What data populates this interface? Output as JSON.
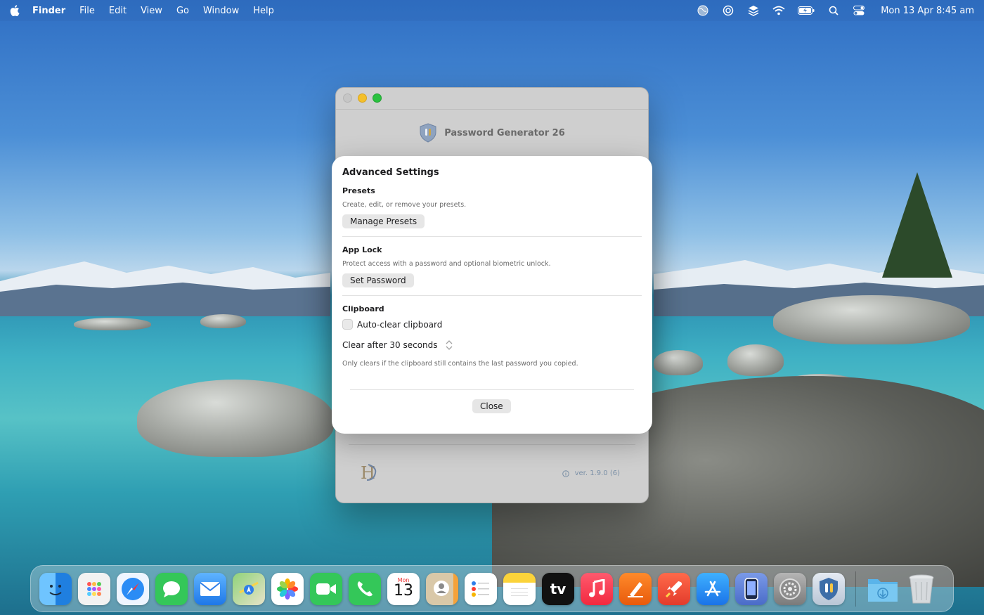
{
  "menubar": {
    "app_name": "Finder",
    "items": [
      "File",
      "Edit",
      "View",
      "Go",
      "Window",
      "Help"
    ],
    "clock": "Mon 13 Apr  8:45 am",
    "status_icons": [
      "globe-icon",
      "lifebuoy-icon",
      "layers-icon",
      "wifi-icon",
      "battery-charging-icon",
      "search-icon",
      "control-center-icon"
    ]
  },
  "window": {
    "title": "Password Generator 26",
    "version": "ver. 1.9.0 (6)",
    "logo_text": "H"
  },
  "sheet": {
    "title": "Advanced Settings",
    "presets": {
      "title": "Presets",
      "description": "Create, edit, or remove your presets.",
      "button": "Manage Presets"
    },
    "app_lock": {
      "title": "App Lock",
      "description": "Protect access with a password and optional biometric unlock.",
      "button": "Set Password"
    },
    "clipboard": {
      "title": "Clipboard",
      "checkbox_label": "Auto-clear clipboard",
      "checked": false,
      "stepper_label": "Clear after 30 seconds",
      "note": "Only clears if the clipboard still contains the last password you copied."
    },
    "close_button": "Close"
  },
  "dock": {
    "apps": [
      {
        "name": "finder-icon",
        "color": "#1f8ff0"
      },
      {
        "name": "launchpad-icon",
        "color": "#eeeeee"
      },
      {
        "name": "safari-icon",
        "color": "#e9f3ff"
      },
      {
        "name": "messages-icon",
        "color": "#34c759"
      },
      {
        "name": "mail-icon",
        "color": "#2f8df5"
      },
      {
        "name": "maps-icon",
        "color": "#5fc06a"
      },
      {
        "name": "photos-icon",
        "color": "#ffffff"
      },
      {
        "name": "facetime-icon",
        "color": "#34c759"
      },
      {
        "name": "phone-icon",
        "color": "#34c759"
      },
      {
        "name": "calendar-icon",
        "color": "#ffffff"
      },
      {
        "name": "contacts-icon",
        "color": "#c9b79a"
      },
      {
        "name": "reminders-icon",
        "color": "#ffffff"
      },
      {
        "name": "notes-icon",
        "color": "#fbe36b"
      },
      {
        "name": "apple-tv-icon",
        "color": "#111111"
      },
      {
        "name": "music-icon",
        "color": "#fa3a55"
      },
      {
        "name": "pages-icon",
        "color": "#f36b1f"
      },
      {
        "name": "rocket-icon",
        "color": "#ef4a3c"
      },
      {
        "name": "app-store-icon",
        "color": "#1e8df5"
      },
      {
        "name": "simulator-icon",
        "color": "#5a7bd6"
      },
      {
        "name": "system-settings-icon",
        "color": "#9a9a9a"
      },
      {
        "name": "password-generator-icon",
        "color": "#3d6ea8"
      }
    ],
    "calendar": {
      "month": "Mon",
      "day": "13"
    },
    "appletv_label": "tv",
    "trailing": [
      {
        "name": "downloads-folder-icon",
        "color": "#6ec1ef"
      },
      {
        "name": "trash-icon",
        "color": "#d8dcdf"
      }
    ]
  }
}
